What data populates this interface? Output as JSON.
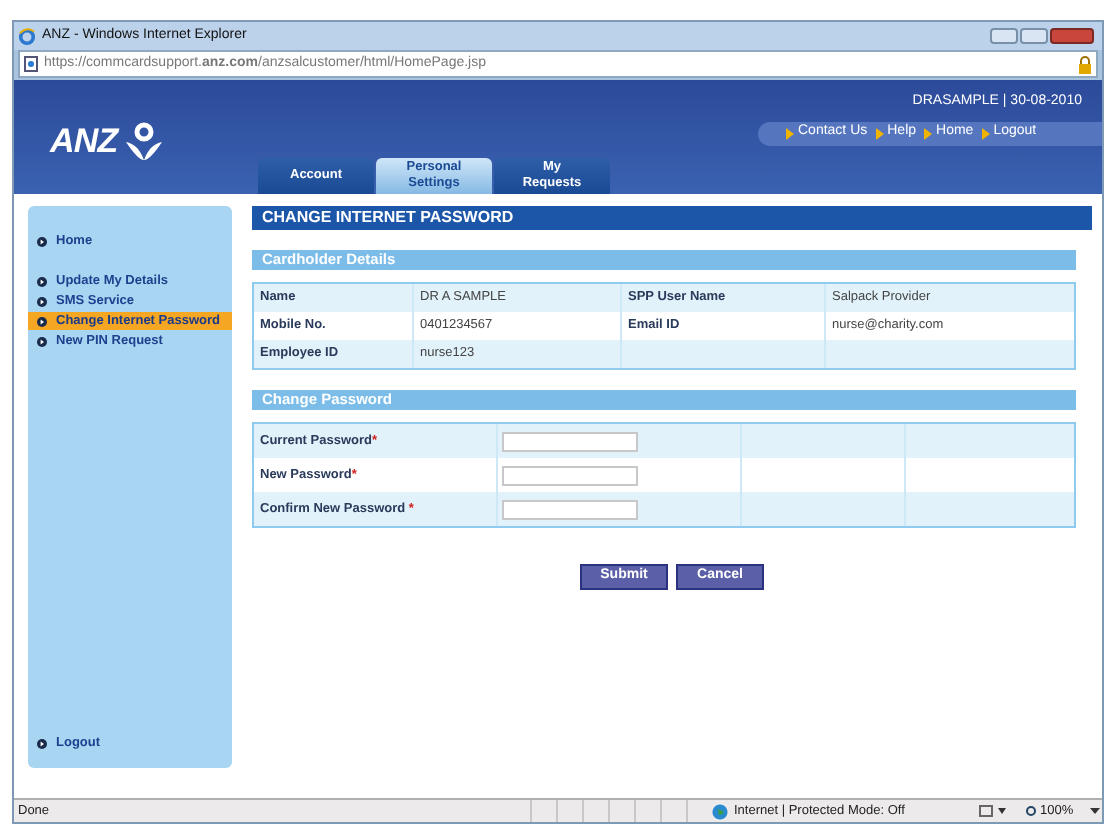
{
  "window": {
    "title": "ANZ - Windows Internet Explorer"
  },
  "address": "https://commcardsupport.**anz.com**/anzsalcustomer/html/HomePage.jsp",
  "header": {
    "logo": "ANZ",
    "user": "DRASAMPLE | 30-08-2010",
    "links": [
      "Contact Us",
      "Help",
      "Home",
      "Logout"
    ],
    "tabs": [
      {
        "label": "Account",
        "selected": false
      },
      {
        "label": "Personal Settings",
        "selected": true
      },
      {
        "label": "My Requests",
        "selected": false
      }
    ]
  },
  "sidebar": {
    "top": [
      {
        "label": "Home",
        "selected": false
      }
    ],
    "items": [
      {
        "label": "Update My Details",
        "selected": false
      },
      {
        "label": "SMS Service",
        "selected": false
      },
      {
        "label": "Change Internet Password",
        "selected": true
      },
      {
        "label": "New PIN Request",
        "selected": false
      }
    ],
    "bottom": [
      {
        "label": "Logout",
        "selected": false
      }
    ]
  },
  "page_title": "CHANGE INTERNET PASSWORD",
  "details": {
    "heading": "Cardholder Details",
    "rows": [
      [
        "Name",
        "DR A SAMPLE",
        "SPP User Name",
        "Salpack Provider"
      ],
      [
        "Mobile No.",
        "0401234567",
        "Email ID",
        "nurse@charity.com"
      ],
      [
        "Employee ID",
        "nurse123",
        "",
        ""
      ]
    ]
  },
  "password": {
    "heading": "Change Password",
    "fields": [
      {
        "label": "Current Password",
        "required": "*"
      },
      {
        "label": "New Password",
        "required": "*"
      },
      {
        "label": "Confirm New Password ",
        "required": "*"
      }
    ]
  },
  "buttons": [
    "Submit",
    "Cancel"
  ],
  "status_bar": {
    "text": "Done",
    "zone": "Internet | Protected Mode: Off",
    "zoom": "100%"
  }
}
